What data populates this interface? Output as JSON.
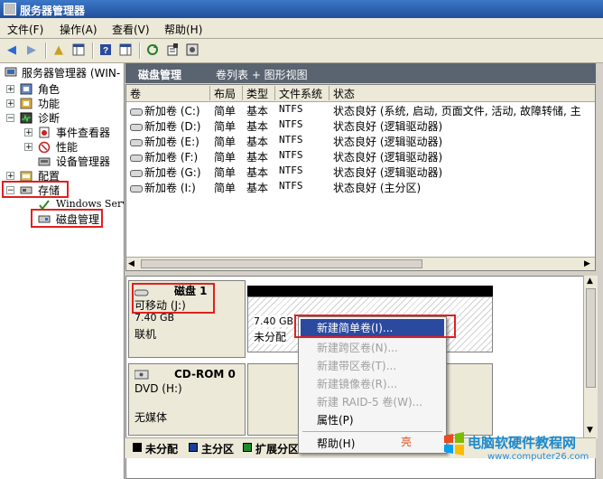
{
  "window": {
    "title": "服务器管理器"
  },
  "menu": [
    "文件(F)",
    "操作(A)",
    "查看(V)",
    "帮助(H)"
  ],
  "tree": {
    "root": "服务器管理器 (WIN-",
    "roles": "角色",
    "features": "功能",
    "diagnostics": "诊断",
    "event_viewer": "事件查看器",
    "performance": "性能",
    "device_manager": "设备管理器",
    "configuration": "配置",
    "storage": "存储",
    "windows_backup": "Windows Serv",
    "disk_management": "磁盘管理"
  },
  "header": {
    "title": "磁盘管理",
    "views": "卷列表 + 图形视图"
  },
  "columns": [
    "卷",
    "布局",
    "类型",
    "文件系统",
    "状态"
  ],
  "volumes": [
    {
      "name": "新加卷 (C:)",
      "layout": "简单",
      "type": "基本",
      "fs": "NTFS",
      "status": "状态良好 (系统, 启动, 页面文件, 活动, 故障转储, 主"
    },
    {
      "name": "新加卷 (D:)",
      "layout": "简单",
      "type": "基本",
      "fs": "NTFS",
      "status": "状态良好 (逻辑驱动器)"
    },
    {
      "name": "新加卷 (E:)",
      "layout": "简单",
      "type": "基本",
      "fs": "NTFS",
      "status": "状态良好 (逻辑驱动器)"
    },
    {
      "name": "新加卷 (F:)",
      "layout": "简单",
      "type": "基本",
      "fs": "NTFS",
      "status": "状态良好 (逻辑驱动器)"
    },
    {
      "name": "新加卷 (G:)",
      "layout": "简单",
      "type": "基本",
      "fs": "NTFS",
      "status": "状态良好 (逻辑驱动器)"
    },
    {
      "name": "新加卷 (I:)",
      "layout": "简单",
      "type": "基本",
      "fs": "NTFS",
      "status": "状态良好 (主分区)"
    }
  ],
  "disk1": {
    "name": "磁盘 1",
    "kind": "可移动 (J:)",
    "size": "7.40 GB",
    "state": "联机",
    "part_size": "7.40 GB",
    "part_state": "未分配"
  },
  "cdrom": {
    "name": "CD-ROM 0",
    "kind": "DVD (H:)",
    "state": "无媒体"
  },
  "context_menu": [
    {
      "label": "新建简单卷(I)...",
      "enabled": true,
      "highlighted": true
    },
    {
      "label": "新建跨区卷(N)...",
      "enabled": false
    },
    {
      "label": "新建带区卷(T)...",
      "enabled": false
    },
    {
      "label": "新建镜像卷(R)...",
      "enabled": false
    },
    {
      "label": "新建 RAID-5 卷(W)...",
      "enabled": false
    },
    {
      "label": "属性(P)",
      "enabled": true
    },
    {
      "label": "帮助(H)",
      "enabled": true
    }
  ],
  "legend": [
    {
      "label": "未分配",
      "color": "#000000"
    },
    {
      "label": "主分区",
      "color": "#1a3d9a"
    },
    {
      "label": "扩展分区",
      "color": "#1e8a2a"
    }
  ],
  "watermark": {
    "brand": "电脑软硬件教程网",
    "url": "www.computer26.com",
    "tag": "亮"
  },
  "colors": {
    "header": "#5a6470",
    "highlight": "#2a4aa0",
    "annotation": "#e02020"
  }
}
